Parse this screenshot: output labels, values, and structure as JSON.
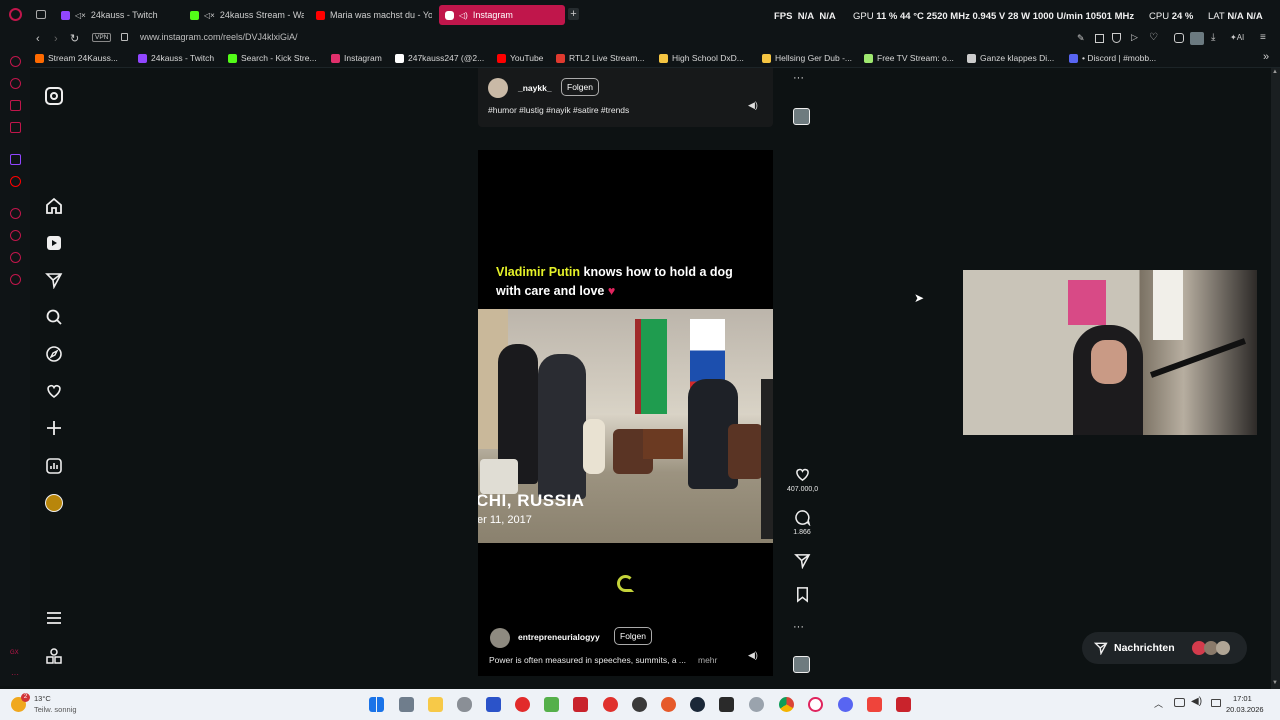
{
  "browser": {
    "tabs": [
      {
        "label": "24kauss - Twitch",
        "color": "#9146ff"
      },
      {
        "label": "24kauss Stream - Wat",
        "color": "#53fc18"
      },
      {
        "label": "Maria was machst du - Yo",
        "color": "#ff0000"
      },
      {
        "label": "Instagram",
        "color": "#e1306c"
      }
    ],
    "new_tab": "+",
    "url": "www.instagram.com/reels/DVJ4klxiGiA/",
    "vpn": "VPN",
    "stats": {
      "fps": "FPS",
      "fps_val1": "N/A",
      "fps_val2": "N/A",
      "gpu": "GPU",
      "gpu_load": "11 %",
      "gpu_temp": "44 °C",
      "gpu_clock": "2520 MHz",
      "gpu_volt": "0.945 V",
      "gpu_power": "28 W",
      "gpu_fan": "1000 U/min",
      "gpu_mem": "10501 MHz",
      "cpu": "CPU",
      "cpu_val": "24 %",
      "lat": "LAT",
      "lat_val1": "N/A",
      "lat_val2": "N/A"
    },
    "bookmarks": [
      {
        "label": "Stream 24Kauss...",
        "color": "#ff6a00"
      },
      {
        "label": "24kauss - Twitch",
        "color": "#9146ff"
      },
      {
        "label": "Search - Kick Stre...",
        "color": "#53fc18"
      },
      {
        "label": "Instagram",
        "color": "#e1306c"
      },
      {
        "label": "247kauss247 (@2...",
        "color": "#ffffff"
      },
      {
        "label": "YouTube",
        "color": "#ff0000"
      },
      {
        "label": "RTL2 Live Stream...",
        "color": "#e03a2f"
      },
      {
        "label": "High School DxD...",
        "color": "#f5c542"
      },
      {
        "label": "Hellsing Ger Dub -...",
        "color": "#f5c542"
      },
      {
        "label": "Free TV Stream: o...",
        "color": "#9fe870"
      },
      {
        "label": "Ganze klappes Di...",
        "color": "#cccccc"
      },
      {
        "label": "• Discord | #mobb...",
        "color": "#5865f2"
      }
    ]
  },
  "reel_top": {
    "username": "_naykk_",
    "follow": "Folgen",
    "caption": "#humor #lustig #nayik #satire #trends"
  },
  "reel_main": {
    "headline_highlight": "Vladimir Putin",
    "headline_rest": " knows how to hold a dog with care and love",
    "heart": "♥",
    "location": "CHI, RUSSIA",
    "date": "er 11, 2017",
    "username": "entrepreneurialogyy",
    "follow": "Folgen",
    "caption": "Power is often measured in speeches, summits, a ...",
    "more": "mehr"
  },
  "actions": {
    "likes": "407.000,0",
    "comments": "1.866",
    "more": "···"
  },
  "messages": {
    "label": "Nachrichten"
  },
  "taskbar": {
    "weather_temp": "13°C",
    "weather_desc": "Teilw. sonnig",
    "time": "17:01",
    "date": "20.03.2026",
    "notif_count": "2"
  }
}
